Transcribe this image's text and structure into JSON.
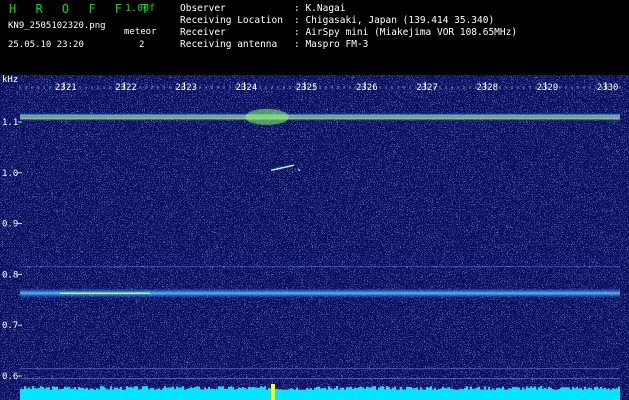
{
  "header": {
    "app_name": "H R O F F T",
    "version": "1.00f",
    "filename": "KN9_2505102320.png",
    "mode": "meteor",
    "datetime": "25.05.10 23:20",
    "count": "2",
    "info": [
      {
        "label": "Observer",
        "value": ": K.Nagai"
      },
      {
        "label": "Receiving Location",
        "value": ": Chigasaki, Japan (139.414 35.340)"
      },
      {
        "label": "Receiver",
        "value": ": AirSpy mini (Miakejima VOR 108.65MHz)"
      },
      {
        "label": "Receiving antenna",
        "value": ": Maspro FM-3"
      }
    ]
  },
  "spectrogram": {
    "y_unit": "kHz",
    "y_ticks": [
      "1.1",
      "1.0",
      "0.9",
      "0.8",
      "0.7",
      "0.6"
    ],
    "time_ticks": [
      "2321",
      "2322",
      "2323",
      "2324",
      "2325",
      "2326",
      "2327",
      "2328",
      "2329",
      "2330"
    ],
    "colors": {
      "background": "#0a0d5e",
      "carrier": "#ff3333",
      "band": "#4fd0ff",
      "noise_floor": "#00e6ff",
      "marker": "#ffff00"
    }
  }
}
